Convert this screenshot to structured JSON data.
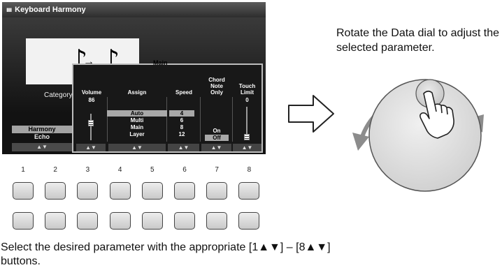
{
  "screen": {
    "title": "Keyboard Harmony",
    "keyboard_glyph": "ıııı",
    "notation_label": "Main",
    "category_label": "Category",
    "side_list": [
      "Harmony",
      "Echo"
    ],
    "side_list_selected": "Harmony",
    "arrows_label": "▲▼",
    "popup": {
      "columns": [
        {
          "label": "Volume",
          "values": [
            "86"
          ]
        },
        {
          "label": "Assign",
          "values": [
            "Auto",
            "Multi",
            "Main",
            "Layer"
          ],
          "selected": "Auto"
        },
        {
          "label": "Speed",
          "values": [
            "4",
            "6",
            "8",
            "12"
          ],
          "selected": "4"
        },
        {
          "label": "Chord\nNote\nOnly",
          "values": [
            "On",
            "Off"
          ],
          "selected": "Off"
        },
        {
          "label": "Touch\nLimit",
          "values": [
            "0"
          ]
        }
      ],
      "volume_slider_level": 0.68,
      "touch_limit_slider_level": 0.0
    }
  },
  "dial": {
    "caption": "Rotate the Data dial to adjust the selected parameter.",
    "icon": "hand-pointer-icon"
  },
  "buttons": {
    "numbers": [
      "1",
      "2",
      "3",
      "4",
      "5",
      "6",
      "7",
      "8"
    ],
    "instruction": "Select the desired parameter with the appropriate [1▲▼] – [8▲▼] buttons."
  },
  "colors": {
    "lcd_background": "#161616",
    "selection_highlight": "#a8a8a8",
    "dial_arrow": "#8c8c8c",
    "dial_face": "#d9d9d9"
  }
}
